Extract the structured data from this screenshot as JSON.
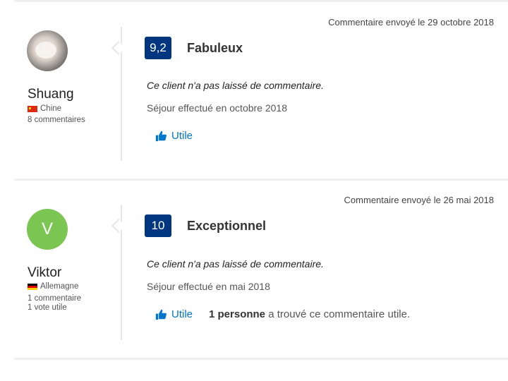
{
  "colors": {
    "score_bg": "#003580",
    "link": "#0077cc",
    "avatar_v": "#7bc653"
  },
  "reviews": [
    {
      "date": "Commentaire envoyé le 29 octobre 2018",
      "avatar_type": "photo",
      "name": "Shuang",
      "country": "Chine",
      "meta_lines": [
        "8 commentaires"
      ],
      "score": "9,2",
      "score_label": "Fabuleux",
      "comment": "Ce client n'a pas laissé de commentaire.",
      "stay": "Séjour effectué en octobre 2018",
      "helpful_label": "Utile"
    },
    {
      "date": "Commentaire envoyé le 26 mai 2018",
      "avatar_letter": "V",
      "name": "Viktor",
      "country": "Allemagne",
      "meta_lines": [
        "1 commentaire",
        "1 vote utile"
      ],
      "score": "10",
      "score_label": "Exceptionnel",
      "comment": "Ce client n'a pas laissé de commentaire.",
      "stay": "Séjour effectué en mai 2018",
      "helpful_label": "Utile",
      "helpful_count_bold": "1 personne",
      "helpful_count_rest": " a trouvé ce commentaire utile."
    }
  ]
}
